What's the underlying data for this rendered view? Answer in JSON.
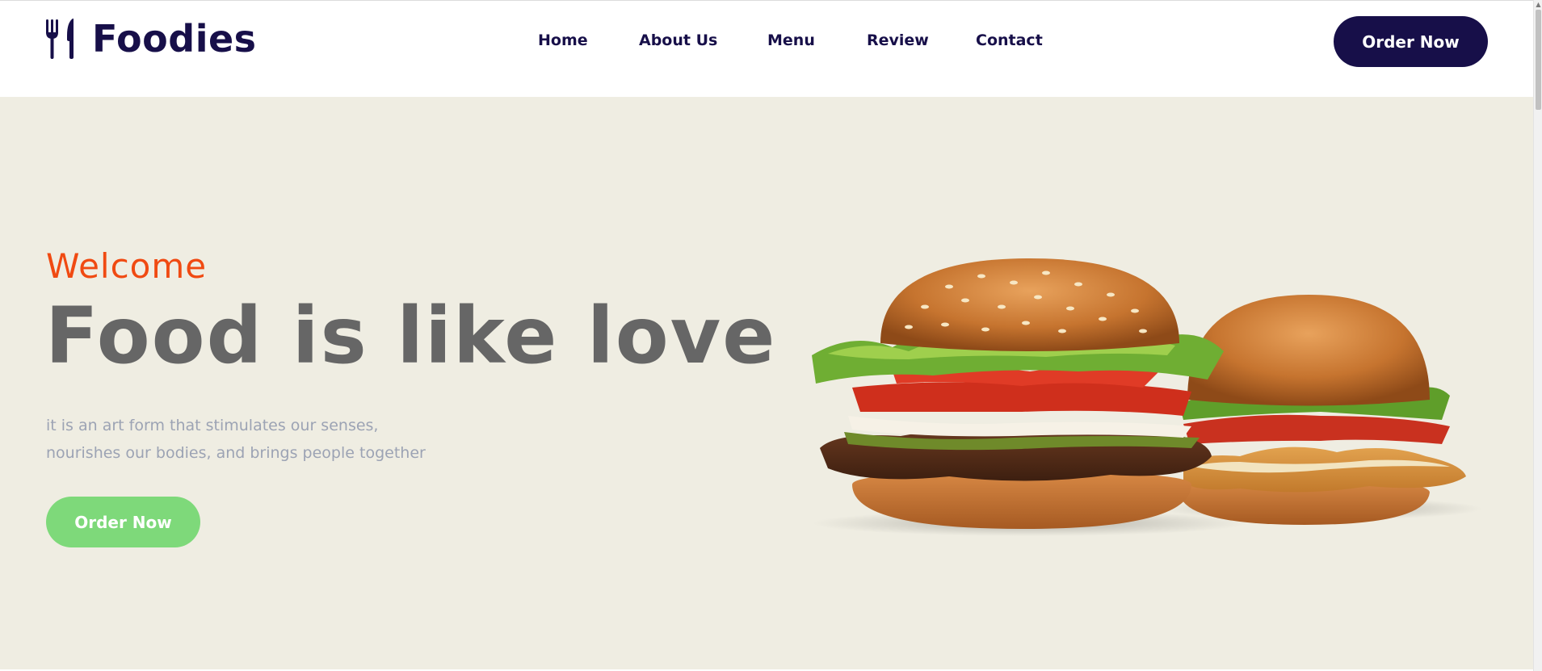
{
  "brand": {
    "name": "Foodies",
    "icon": "utensils-icon",
    "color": "#170f49"
  },
  "nav": {
    "items": [
      {
        "label": "Home"
      },
      {
        "label": "About Us"
      },
      {
        "label": "Menu"
      },
      {
        "label": "Review"
      },
      {
        "label": "Contact"
      }
    ],
    "cta_label": "Order Now"
  },
  "hero": {
    "eyebrow": "Welcome",
    "title": "Food is like love",
    "description_line1": "it is an art form that stimulates our senses,",
    "description_line2": "nourishes our bodies, and brings people together",
    "cta_label": "Order Now",
    "image": "burgers-image",
    "background": "#efede2",
    "accent": "#f04a12",
    "cta_color": "#7ed97a"
  }
}
